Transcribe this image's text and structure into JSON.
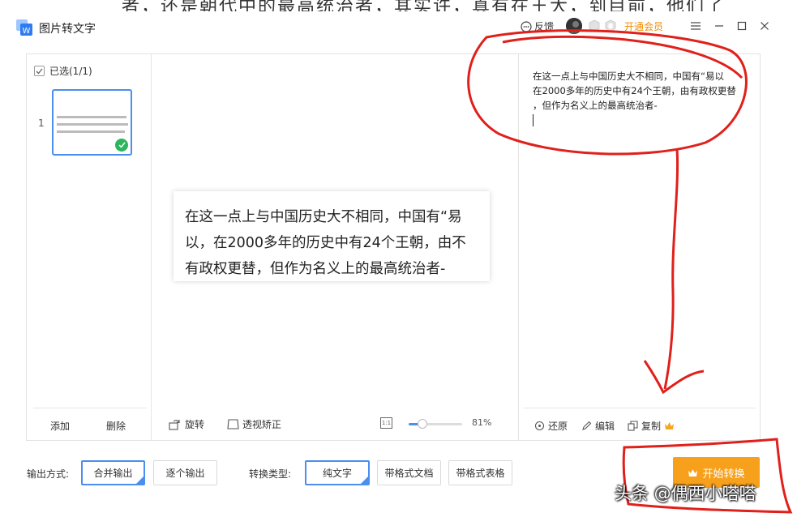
{
  "background_doc": {
    "text": "者，还是朝代中的最高统治者，其实许，真有在王大，到目前，他们了"
  },
  "app": {
    "title": "图片转文字",
    "feedback_label": "反馈",
    "vip_link": "开通会员"
  },
  "left_panel": {
    "select_all_label": "已选(1/1)",
    "thumb_number": "1",
    "add_label": "添加",
    "delete_label": "删除"
  },
  "preview": {
    "lines": [
      "在这一点上与中国历史大不相同，中国有“易",
      "以，在2000多年的历史中有24个王朝，由不",
      "有政权更替，但作为名义上的最高统治者-"
    ],
    "rotate_label": "旋转",
    "perspective_label": "透视矫正",
    "zoom_percent": 81,
    "zoom_label": "81%"
  },
  "result": {
    "lines": [
      "在这一点上与中国历史大不相同，中国有“易以",
      "在2000多年的历史中有24个王朝，由有政权更替",
      "，但作为名义上的最高统治者-"
    ],
    "restore_label": "还原",
    "edit_label": "编辑",
    "copy_label": "复制"
  },
  "options": {
    "output_mode_label": "输出方式:",
    "merge_output": "合并输出",
    "single_output": "逐个输出",
    "convert_type_label": "转换类型:",
    "plain_text": "纯文字",
    "formatted_doc": "带格式文档",
    "formatted_table": "带格式表格",
    "start_label": "开始转换"
  },
  "watermark": "头条 @偶西小嗒嗒",
  "colors": {
    "accent": "#4a8ef0",
    "vip": "#f08c00",
    "start": "#f7a01b",
    "success": "#2db55d",
    "annotation": "#e0201b"
  }
}
